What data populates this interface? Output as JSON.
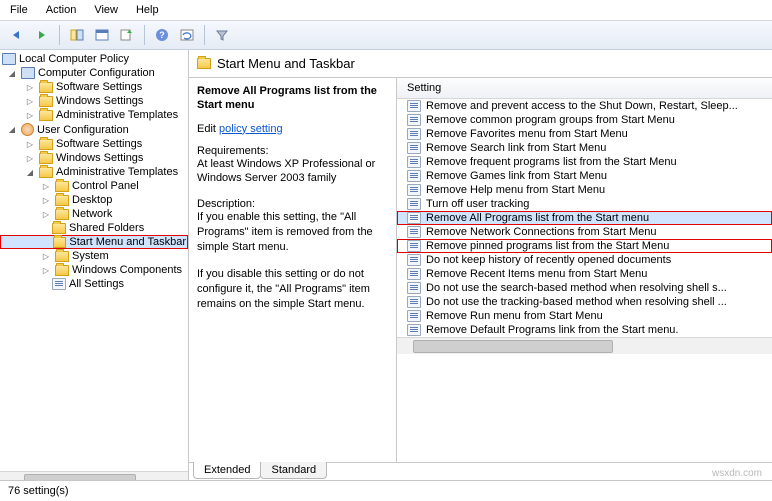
{
  "menu": {
    "file": "File",
    "action": "Action",
    "view": "View",
    "help": "Help"
  },
  "tree": {
    "root": "Local Computer Policy",
    "cc": "Computer Configuration",
    "uc": "User Configuration",
    "ss": "Software Settings",
    "ws": "Windows Settings",
    "at": "Administrative Templates",
    "cp": "Control Panel",
    "dt": "Desktop",
    "nw": "Network",
    "sf": "Shared Folders",
    "smt": "Start Menu and Taskbar",
    "sys": "System",
    "wc": "Windows Components",
    "all": "All Settings"
  },
  "crumb": {
    "title": "Start Menu and Taskbar"
  },
  "desc": {
    "heading": "Remove All Programs list from the Start menu",
    "edit_prefix": "Edit ",
    "edit_link": "policy setting ",
    "req_label": "Requirements:",
    "req_text": "At least Windows XP Professional or Windows Server 2003 family",
    "desc_label": "Description:",
    "desc_text1": "If you enable this setting, the \"All Programs\" item is removed from the simple Start menu.",
    "desc_text2": "If you disable this setting or do not configure it, the \"All Programs\" item remains on the simple Start menu."
  },
  "list": {
    "header": "Setting",
    "items": [
      "Remove and prevent access to the Shut Down, Restart, Sleep...",
      "Remove common program groups from Start Menu",
      "Remove Favorites menu from Start Menu",
      "Remove Search link from Start Menu",
      "Remove frequent programs list from the Start Menu",
      "Remove Games link from Start Menu",
      "Remove Help menu from Start Menu",
      "Turn off user tracking",
      "Remove All Programs list from the Start menu",
      "Remove Network Connections from Start Menu",
      "Remove pinned programs list from the Start Menu",
      "Do not keep history of recently opened documents",
      "Remove Recent Items menu from Start Menu",
      "Do not use the search-based method when resolving shell s...",
      "Do not use the tracking-based method when resolving shell ...",
      "Remove Run menu from Start Menu",
      "Remove Default Programs link from the Start menu."
    ]
  },
  "tabs": {
    "extended": "Extended",
    "standard": "Standard"
  },
  "status": "76 setting(s)",
  "watermark": "wsxdn.com"
}
